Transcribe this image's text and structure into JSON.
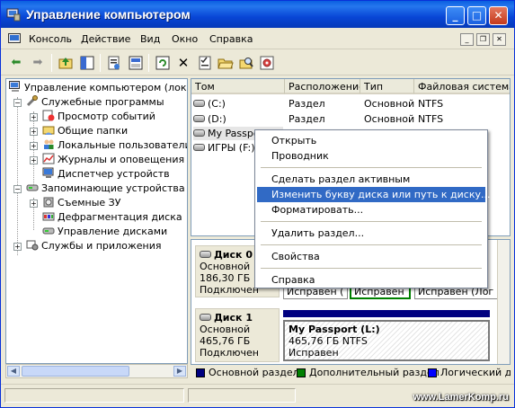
{
  "window": {
    "title": "Управление компьютером",
    "btn_min": "_",
    "btn_max": "□",
    "btn_close": "✕"
  },
  "menu": [
    "Консоль",
    "Действие",
    "Вид",
    "Окно",
    "Справка"
  ],
  "mdi": {
    "min": "_",
    "restore": "❐",
    "close": "✕"
  },
  "tree": [
    {
      "label": "Управление компьютером (локаль",
      "icon": "computer-icon"
    },
    {
      "label": "Служебные программы",
      "icon": "tools-icon"
    },
    {
      "label": "Просмотр событий",
      "icon": "event-viewer-icon"
    },
    {
      "label": "Общие папки",
      "icon": "shared-folder-icon"
    },
    {
      "label": "Локальные пользователи",
      "icon": "users-icon"
    },
    {
      "label": "Журналы и оповещения п",
      "icon": "performance-icon"
    },
    {
      "label": "Диспетчер устройств",
      "icon": "device-manager-icon"
    },
    {
      "label": "Запоминающие устройства",
      "icon": "storage-icon"
    },
    {
      "label": "Съемные ЗУ",
      "icon": "removable-storage-icon"
    },
    {
      "label": "Дефрагментация диска",
      "icon": "defrag-icon"
    },
    {
      "label": "Управление дисками",
      "icon": "disk-management-icon"
    },
    {
      "label": "Службы и приложения",
      "icon": "services-icon"
    }
  ],
  "columns": [
    "Том",
    "Расположение",
    "Тип",
    "Файловая система"
  ],
  "volumes": [
    {
      "name": "(C:)",
      "location": "Раздел",
      "type": "Основной",
      "fs": "NTFS"
    },
    {
      "name": "(D:)",
      "location": "Раздел",
      "type": "Основной",
      "fs": "NTFS"
    },
    {
      "name": "My Passport (L:)",
      "location": "",
      "type": "",
      "fs": ""
    },
    {
      "name": "ИГРЫ (F:)",
      "location": "",
      "type": "",
      "fs": ""
    }
  ],
  "disks": [
    {
      "title": "Диск 0",
      "kind": "Основной",
      "size": "186,30 ГБ",
      "state": "Подключен",
      "partitions": [
        "Исправен (",
        "Исправен",
        "Исправен (Лог"
      ]
    },
    {
      "title": "Диск 1",
      "kind": "Основной",
      "size": "465,76 ГБ",
      "state": "Подключен",
      "part_name": "My Passport  (L:)",
      "part_size": "465,76 ГБ NTFS",
      "part_state": "Исправен"
    }
  ],
  "legend": [
    {
      "label": "Основной раздел",
      "color": "#000080"
    },
    {
      "label": "Дополнительный раздел",
      "color": "#008000"
    },
    {
      "label": "Логический ди",
      "color": "#0000ff"
    }
  ],
  "context_menu": [
    "Открыть",
    "Проводник",
    "Сделать раздел активным",
    "Изменить букву диска или путь к диску...",
    "Форматировать...",
    "Удалить раздел...",
    "Свойства",
    "Справка"
  ],
  "watermark": "www.LamerKomp.ru",
  "colors": {
    "titlebar": "#0a5fe0",
    "highlight": "#316ac5",
    "primary_partition": "#000080"
  }
}
